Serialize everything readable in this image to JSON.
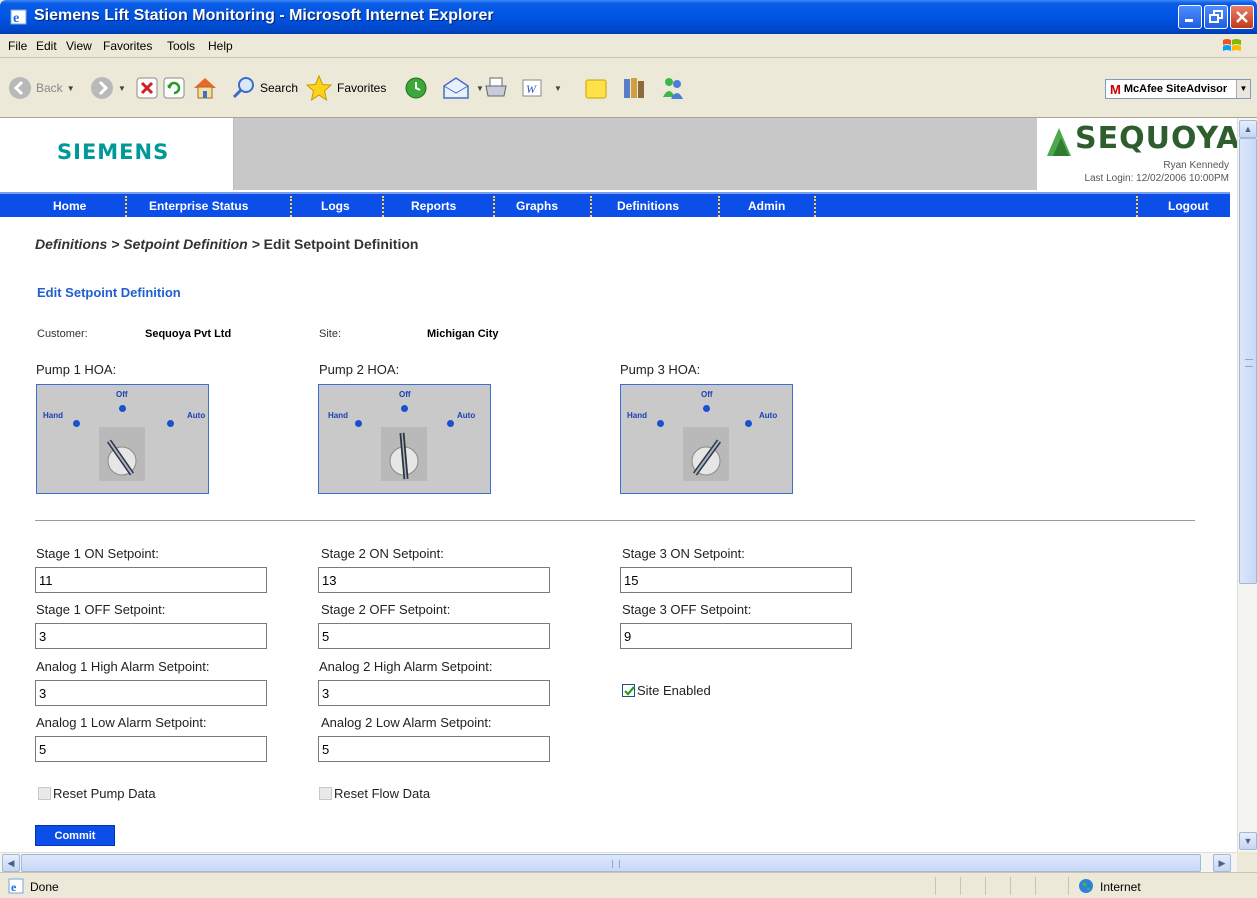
{
  "window": {
    "title": "Siemens Lift Station Monitoring - Microsoft Internet Explorer"
  },
  "menu": [
    "File",
    "Edit",
    "View",
    "Favorites",
    "Tools",
    "Help"
  ],
  "toolbar": {
    "back": "Back",
    "search": "Search",
    "favorites": "Favorites",
    "mcafee": "McAfee SiteAdvisor",
    "mcafee_brand": "M"
  },
  "header": {
    "brand": "SIEMENS",
    "partner": "SEQUOYA",
    "user": "Ryan Kennedy",
    "last_login": "Last Login: 12/02/2006 10:00PM"
  },
  "nav": [
    "Home",
    "Enterprise Status",
    "Logs",
    "Reports",
    "Graphs",
    "Definitions",
    "Admin"
  ],
  "nav_logout": "Logout",
  "breadcrumb": {
    "part1": "Definitions > Setpoint Definition >",
    "part2": "Edit Setpoint Definition"
  },
  "form": {
    "title": "Edit Setpoint Definition",
    "customer_label": "Customer:",
    "customer_value": "Sequoya Pvt Ltd",
    "site_label": "Site:",
    "site_value": "Michigan City",
    "hoa_labels": {
      "hand": "Hand",
      "off": "Off",
      "auto": "Auto"
    },
    "pumps": [
      {
        "label": "Pump 1 HOA:",
        "position": "Hand"
      },
      {
        "label": "Pump 2 HOA:",
        "position": "Off"
      },
      {
        "label": "Pump 3 HOA:",
        "position": "Auto"
      }
    ],
    "fields": {
      "stage1_on": {
        "label": "Stage 1 ON Setpoint:",
        "value": "11"
      },
      "stage2_on": {
        "label": "Stage 2 ON Setpoint:",
        "value": "13"
      },
      "stage3_on": {
        "label": "Stage 3 ON Setpoint:",
        "value": "15"
      },
      "stage1_off": {
        "label": "Stage 1 OFF Setpoint:",
        "value": "3"
      },
      "stage2_off": {
        "label": "Stage 2 OFF Setpoint:",
        "value": "5"
      },
      "stage3_off": {
        "label": "Stage 3 OFF Setpoint:",
        "value": "9"
      },
      "analog1_high": {
        "label": "Analog 1 High Alarm Setpoint:",
        "value": "3"
      },
      "analog2_high": {
        "label": "Analog 2 High Alarm Setpoint:",
        "value": "3"
      },
      "analog1_low": {
        "label": "Analog 1 Low Alarm Setpoint:",
        "value": "5"
      },
      "analog2_low": {
        "label": "Analog 2 Low Alarm Setpoint:",
        "value": "5"
      }
    },
    "site_enabled": {
      "label": "Site Enabled",
      "checked": true
    },
    "reset_pump": {
      "label": "Reset Pump Data",
      "checked": false
    },
    "reset_flow": {
      "label": "Reset Flow Data",
      "checked": false
    },
    "commit": "Commit"
  },
  "status": {
    "text": "Done",
    "zone": "Internet"
  },
  "colors": {
    "nav": "#0b4ee8",
    "brand": "#009999",
    "accent": "#1f5fd0"
  }
}
